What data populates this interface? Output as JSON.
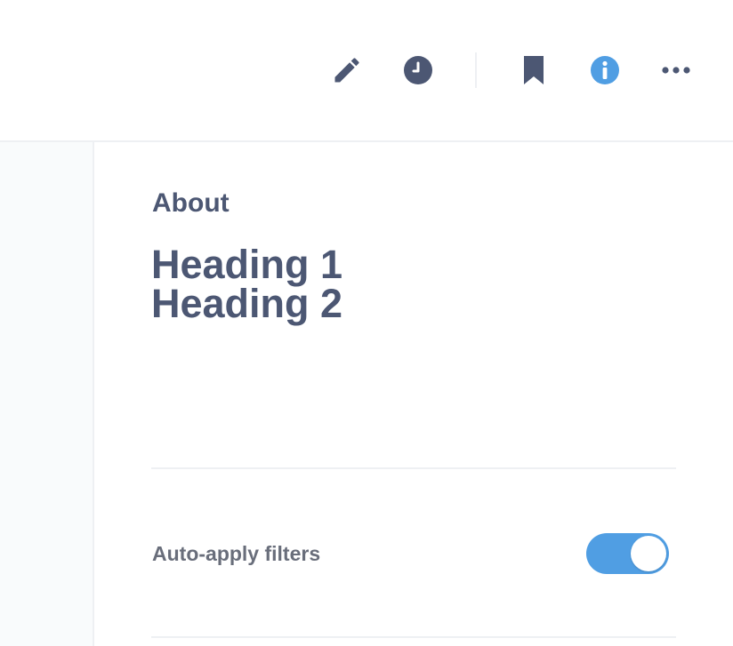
{
  "toolbar": {
    "buttons": [
      {
        "icon": "pencil-icon",
        "action": "edit"
      },
      {
        "icon": "clock-icon",
        "action": "history"
      },
      {
        "icon": "bookmark-icon",
        "action": "bookmark"
      },
      {
        "icon": "info-icon",
        "action": "info",
        "active": true
      },
      {
        "icon": "ellipsis-icon",
        "action": "more"
      }
    ],
    "colors": {
      "icon": "#4c5773",
      "active": "#509ee3"
    }
  },
  "info_panel": {
    "section_label": "About",
    "description_lines": [
      "Heading 1",
      "Heading 2"
    ],
    "settings": [
      {
        "label": "Auto-apply filters",
        "enabled": true
      }
    ]
  },
  "theme": {
    "toggle_on": "#509ee3",
    "text": "#4c5773",
    "muted_text": "#696e7b",
    "border": "#eef0f3",
    "sidebar_bg": "#f9fbfc"
  }
}
